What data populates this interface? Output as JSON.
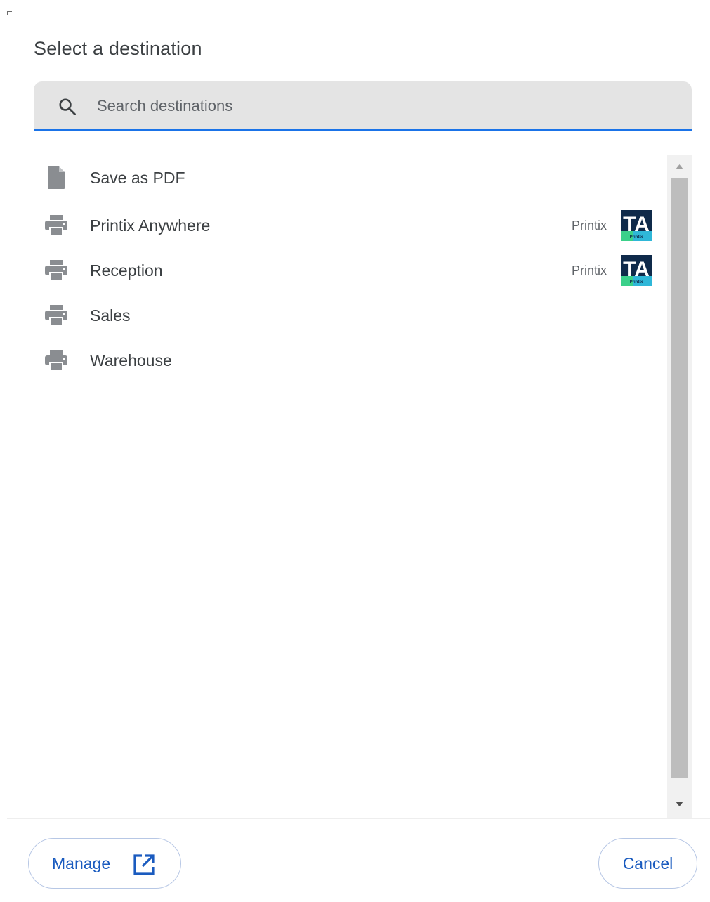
{
  "dialog": {
    "title": "Select a destination"
  },
  "search": {
    "placeholder": "Search destinations",
    "value": ""
  },
  "destinations": [
    {
      "label": "Save as PDF",
      "icon": "document-icon",
      "provider": "",
      "logo": ""
    },
    {
      "label": "Printix Anywhere",
      "icon": "printer-icon",
      "provider": "Printix",
      "logo": "ta-printix-logo"
    },
    {
      "label": "Reception",
      "icon": "printer-icon",
      "provider": "Printix",
      "logo": "ta-printix-logo"
    },
    {
      "label": "Sales",
      "icon": "printer-icon",
      "provider": "",
      "logo": ""
    },
    {
      "label": "Warehouse",
      "icon": "printer-icon",
      "provider": "",
      "logo": ""
    }
  ],
  "logo": {
    "text": "TA",
    "subtext": "Printix"
  },
  "footer": {
    "manage_label": "Manage",
    "cancel_label": "Cancel"
  },
  "colors": {
    "accent": "#1a73e8",
    "button_text": "#1a5bbf",
    "icon_gray": "#5f6368"
  }
}
